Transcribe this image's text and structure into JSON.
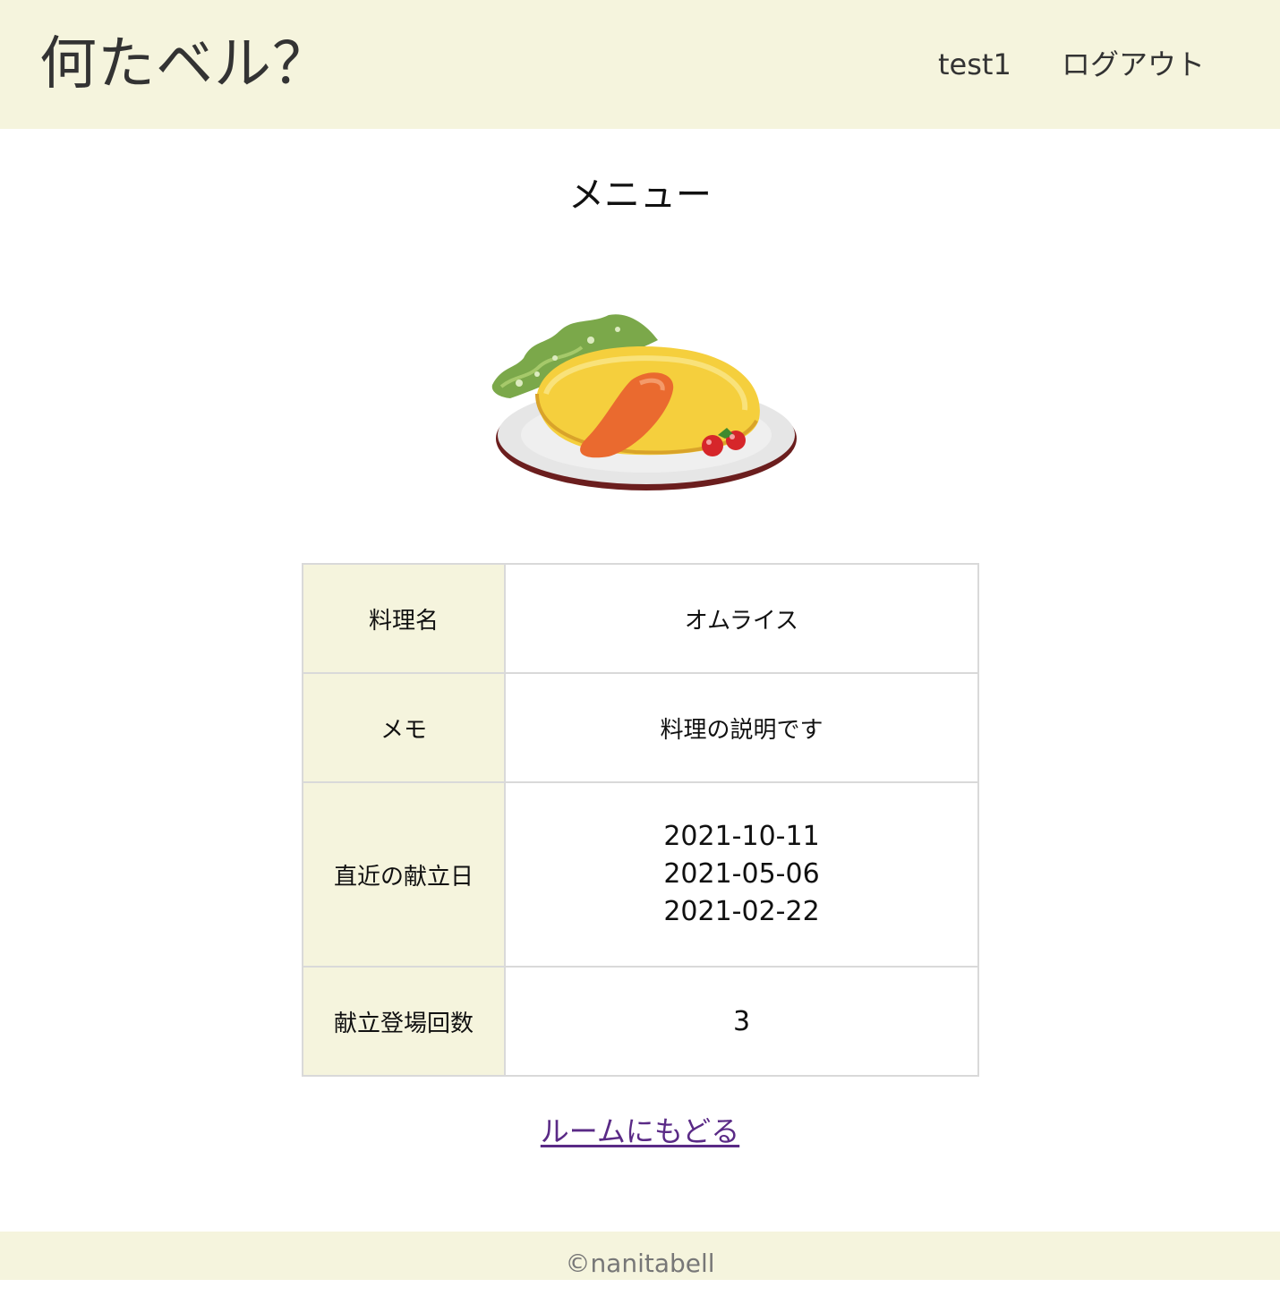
{
  "header": {
    "logo": "何たベル？",
    "user_name": "test1",
    "logout_label": "ログアウト"
  },
  "page": {
    "title": "メニュー"
  },
  "dish_image": {
    "icon": "omurice-illustration"
  },
  "details": {
    "name_label": "料理名",
    "name_value": "オムライス",
    "memo_label": "メモ",
    "memo_value": "料理の説明です",
    "dates_label": "直近の献立日",
    "dates": [
      "2021-10-11",
      "2021-05-06",
      "2021-02-22"
    ],
    "count_label": "献立登場回数",
    "count_value": "3"
  },
  "back_link": {
    "label": "ルームにもどる"
  },
  "footer": {
    "text": "©nanitabell"
  },
  "colors": {
    "header_bg": "#f5f4dd",
    "link": "#5a2a86",
    "border": "#d9d9d9"
  }
}
